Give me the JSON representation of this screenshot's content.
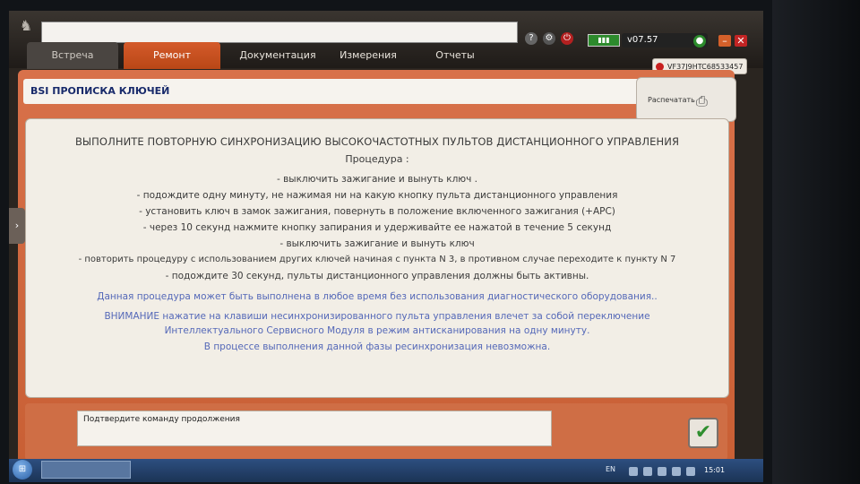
{
  "header": {
    "version": "v07.57",
    "vin": "VF37J9HTC68533457",
    "tabs": [
      {
        "label": "Встреча",
        "state": "dim"
      },
      {
        "label": "Ремонт",
        "state": "active"
      },
      {
        "label": "Документация",
        "state": "normal"
      },
      {
        "label": "Измерения",
        "state": "normal"
      },
      {
        "label": "Отчеты",
        "state": "normal"
      }
    ],
    "icons": [
      "peugeot-logo-icon",
      "help-icon",
      "settings-icon",
      "power-icon",
      "battery-icon",
      "minimize-icon",
      "close-icon"
    ]
  },
  "panel": {
    "title_prefix": "BSI",
    "title": "ПРОПИСКА КЛЮЧЕЙ",
    "print_label": "Распечатать"
  },
  "content": {
    "headline": "ВЫПОЛНИТЕ ПОВТОРНУЮ СИНХРОНИЗАЦИЮ ВЫСОКОЧАСТОТНЫХ ПУЛЬТОВ ДИСТАНЦИОННОГО УПРАВЛЕНИЯ",
    "procedure_label": "Процедура :",
    "steps": [
      "- выключить зажигание и вынуть ключ .",
      "- подождите одну минуту, не нажимая ни на какую кнопку пульта дистанционного управления",
      "- установить ключ в замок зажигания, повернуть в положение включенного зажигания (+APC)",
      "- через 10 секунд нажмите кнопку запирания и удерживайте ее нажатой в течение 5 секунд",
      "- выключить зажигание и вынуть ключ",
      "- повторить процедуру с использованием других ключей начиная с пункта N 3, в противном случае переходите к пункту N 7",
      "- подождите 30 секунд, пульты дистанционного управления должны быть активны."
    ],
    "note": "Данная процедура может быть выполнена в любое время без использования диагностического оборудования..",
    "warning_lines": [
      "ВНИМАНИЕ нажатие на клавиши несинхронизированного пульта управления влечет за собой переключение",
      "Интеллектуального Сервисного Модуля в режим антисканирования на одну минуту.",
      "В процессе выполнения данной фазы ресинхронизация невозможна."
    ]
  },
  "bottom": {
    "confirm_text": "Подтвердите команду продолжения"
  },
  "taskbar": {
    "lang": "EN",
    "clock": "15:01"
  }
}
